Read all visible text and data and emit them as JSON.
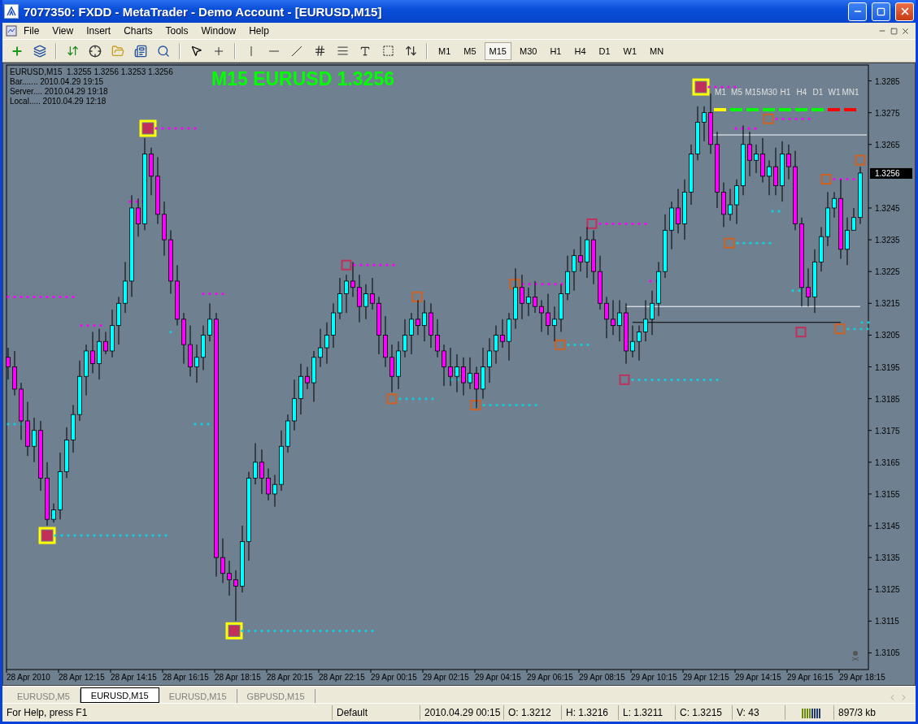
{
  "window": {
    "title": "7077350: FXDD - MetaTrader - Demo Account - [EURUSD,M15]"
  },
  "menu": [
    "File",
    "View",
    "Insert",
    "Charts",
    "Tools",
    "Window",
    "Help"
  ],
  "toolbar": {
    "timeframes": [
      {
        "label": "M1",
        "selected": false
      },
      {
        "label": "M5",
        "selected": false
      },
      {
        "label": "M15",
        "selected": true
      },
      {
        "label": "M30",
        "selected": false
      },
      {
        "label": "H1",
        "selected": false
      },
      {
        "label": "H4",
        "selected": false
      },
      {
        "label": "D1",
        "selected": false
      },
      {
        "label": "W1",
        "selected": false
      },
      {
        "label": "MN",
        "selected": false
      }
    ]
  },
  "chart": {
    "info_lines": [
      "EURUSD,M15  1.3255 1.3256 1.3253 1.3256",
      "Bar....... 2010.04.29 19:15",
      "Server.... 2010.04.29 19:18",
      "Local..... 2010.04.29 12:18"
    ],
    "headline": "M15 EURUSD 1.3256",
    "legend": [
      {
        "label": "M1",
        "color": "#ffff00"
      },
      {
        "label": "M5",
        "color": "#00ff00"
      },
      {
        "label": "M15",
        "color": "#00ff00"
      },
      {
        "label": "M30",
        "color": "#00ff00"
      },
      {
        "label": "H1",
        "color": "#00ff00"
      },
      {
        "label": "H4",
        "color": "#00ff00"
      },
      {
        "label": "D1",
        "color": "#00ff00"
      },
      {
        "label": "W1",
        "color": "#ff0000"
      },
      {
        "label": "MN1",
        "color": "#ff0000"
      }
    ],
    "current_price": "1.3256",
    "time_axis": [
      "28 Apr 2010",
      "28 Apr 12:15",
      "28 Apr 14:15",
      "28 Apr 16:15",
      "28 Apr 18:15",
      "28 Apr 20:15",
      "28 Apr 22:15",
      "29 Apr 00:15",
      "29 Apr 02:15",
      "29 Apr 04:15",
      "29 Apr 06:15",
      "29 Apr 08:15",
      "29 Apr 10:15",
      "29 Apr 12:15",
      "29 Apr 14:15",
      "29 Apr 16:15",
      "29 Apr 18:15"
    ],
    "chart_data": {
      "type": "candlestick",
      "ylim": [
        1.31,
        1.329
      ],
      "ref_lines": [
        {
          "axis": "y",
          "value": 1.3268,
          "color": "#ffffff"
        },
        {
          "axis": "y",
          "value": 1.3214,
          "color": "#ffffff"
        },
        {
          "axis": "y",
          "value": 1.3209,
          "color": "#000000"
        }
      ],
      "yticks": [
        {
          "value": 1.3285,
          "label": "1.3285"
        },
        {
          "value": 1.3275,
          "label": "1.3275"
        },
        {
          "value": 1.3265,
          "label": "1.3265"
        },
        {
          "value": 1.3245,
          "label": "1.3245"
        },
        {
          "value": 1.3235,
          "label": "1.3235"
        },
        {
          "value": 1.3225,
          "label": "1.3225"
        },
        {
          "value": 1.3215,
          "label": "1.3215"
        },
        {
          "value": 1.3205,
          "label": "1.3205"
        },
        {
          "value": 1.3195,
          "label": "1.3195"
        },
        {
          "value": 1.3185,
          "label": "1.3185"
        },
        {
          "value": 1.3175,
          "label": "1.3175"
        },
        {
          "value": 1.3165,
          "label": "1.3165"
        },
        {
          "value": 1.3155,
          "label": "1.3155"
        },
        {
          "value": 1.3145,
          "label": "1.3145"
        },
        {
          "value": 1.3135,
          "label": "1.3135"
        },
        {
          "value": 1.3125,
          "label": "1.3125"
        },
        {
          "value": 1.3115,
          "label": "1.3115"
        },
        {
          "value": 1.3105,
          "label": "1.3105"
        }
      ],
      "ohlc": [
        [
          1.3198,
          1.3201,
          1.3191,
          1.3195
        ],
        [
          1.3195,
          1.32,
          1.3186,
          1.3188
        ],
        [
          1.3188,
          1.319,
          1.3172,
          1.3178
        ],
        [
          1.3178,
          1.3184,
          1.3167,
          1.317
        ],
        [
          1.317,
          1.3179,
          1.3165,
          1.3175
        ],
        [
          1.3175,
          1.3178,
          1.3156,
          1.316
        ],
        [
          1.316,
          1.3165,
          1.3145,
          1.3147
        ],
        [
          1.3147,
          1.3152,
          1.3146,
          1.315
        ],
        [
          1.315,
          1.3168,
          1.3147,
          1.3162
        ],
        [
          1.3162,
          1.3176,
          1.316,
          1.3172
        ],
        [
          1.3172,
          1.3183,
          1.3168,
          1.318
        ],
        [
          1.318,
          1.3197,
          1.3178,
          1.3192
        ],
        [
          1.3192,
          1.3202,
          1.3186,
          1.32
        ],
        [
          1.32,
          1.3206,
          1.3193,
          1.3196
        ],
        [
          1.3196,
          1.3207,
          1.3191,
          1.3203
        ],
        [
          1.3203,
          1.3206,
          1.3199,
          1.32
        ],
        [
          1.32,
          1.3213,
          1.3198,
          1.3208
        ],
        [
          1.3208,
          1.3217,
          1.3202,
          1.3215
        ],
        [
          1.3215,
          1.3228,
          1.3212,
          1.3222
        ],
        [
          1.3222,
          1.3249,
          1.3217,
          1.3245
        ],
        [
          1.3245,
          1.3248,
          1.3236,
          1.324
        ],
        [
          1.324,
          1.3267,
          1.3238,
          1.3262
        ],
        [
          1.3262,
          1.3264,
          1.3249,
          1.3255
        ],
        [
          1.3255,
          1.3261,
          1.324,
          1.3243
        ],
        [
          1.3243,
          1.3247,
          1.323,
          1.3235
        ],
        [
          1.3235,
          1.3238,
          1.3218,
          1.3222
        ],
        [
          1.3222,
          1.3227,
          1.3208,
          1.321
        ],
        [
          1.321,
          1.3212,
          1.3196,
          1.3202
        ],
        [
          1.3202,
          1.3208,
          1.3192,
          1.3195
        ],
        [
          1.3195,
          1.3202,
          1.319,
          1.3198
        ],
        [
          1.3198,
          1.3208,
          1.3194,
          1.3205
        ],
        [
          1.3205,
          1.3215,
          1.3203,
          1.321
        ],
        [
          1.321,
          1.3212,
          1.3129,
          1.3135
        ],
        [
          1.3135,
          1.3141,
          1.3127,
          1.313
        ],
        [
          1.313,
          1.3134,
          1.3123,
          1.3128
        ],
        [
          1.3128,
          1.3131,
          1.3115,
          1.3126
        ],
        [
          1.3126,
          1.3145,
          1.3124,
          1.314
        ],
        [
          1.314,
          1.3162,
          1.3134,
          1.316
        ],
        [
          1.316,
          1.3171,
          1.3158,
          1.3165
        ],
        [
          1.3165,
          1.3169,
          1.3155,
          1.316
        ],
        [
          1.316,
          1.3163,
          1.3153,
          1.3155
        ],
        [
          1.3155,
          1.3161,
          1.3151,
          1.3158
        ],
        [
          1.3158,
          1.3175,
          1.3156,
          1.317
        ],
        [
          1.317,
          1.318,
          1.3168,
          1.3178
        ],
        [
          1.3178,
          1.3191,
          1.3175,
          1.3185
        ],
        [
          1.3185,
          1.3196,
          1.318,
          1.3192
        ],
        [
          1.3192,
          1.3195,
          1.3188,
          1.319
        ],
        [
          1.319,
          1.32,
          1.3184,
          1.3198
        ],
        [
          1.3198,
          1.3207,
          1.3195,
          1.3201
        ],
        [
          1.3201,
          1.3209,
          1.3196,
          1.3205
        ],
        [
          1.3205,
          1.3215,
          1.3201,
          1.3212
        ],
        [
          1.3212,
          1.3223,
          1.321,
          1.3218
        ],
        [
          1.3218,
          1.3224,
          1.3212,
          1.3222
        ],
        [
          1.3222,
          1.3228,
          1.3217,
          1.322
        ],
        [
          1.322,
          1.3224,
          1.3209,
          1.3214
        ],
        [
          1.3214,
          1.3221,
          1.321,
          1.3218
        ],
        [
          1.3218,
          1.3223,
          1.3213,
          1.3215
        ],
        [
          1.3215,
          1.3217,
          1.3199,
          1.3205
        ],
        [
          1.3205,
          1.3211,
          1.3195,
          1.3198
        ],
        [
          1.3198,
          1.3202,
          1.3187,
          1.3192
        ],
        [
          1.3192,
          1.3203,
          1.3188,
          1.32
        ],
        [
          1.32,
          1.321,
          1.3198,
          1.3205
        ],
        [
          1.3205,
          1.3212,
          1.3199,
          1.321
        ],
        [
          1.321,
          1.3216,
          1.3205,
          1.3208
        ],
        [
          1.3208,
          1.3216,
          1.3203,
          1.3212
        ],
        [
          1.3212,
          1.3215,
          1.3201,
          1.3205
        ],
        [
          1.3205,
          1.321,
          1.3198,
          1.32
        ],
        [
          1.32,
          1.3202,
          1.3189,
          1.3195
        ],
        [
          1.3195,
          1.3201,
          1.3189,
          1.3192
        ],
        [
          1.3192,
          1.3199,
          1.3187,
          1.3195
        ],
        [
          1.3195,
          1.3198,
          1.3186,
          1.319
        ],
        [
          1.319,
          1.3198,
          1.3188,
          1.3193
        ],
        [
          1.3193,
          1.3195,
          1.3182,
          1.3188
        ],
        [
          1.3188,
          1.3201,
          1.3185,
          1.3195
        ],
        [
          1.3195,
          1.3204,
          1.319,
          1.32
        ],
        [
          1.32,
          1.3208,
          1.3196,
          1.3205
        ],
        [
          1.3205,
          1.321,
          1.3201,
          1.3203
        ],
        [
          1.3203,
          1.3212,
          1.3197,
          1.321
        ],
        [
          1.321,
          1.3226,
          1.3207,
          1.322
        ],
        [
          1.322,
          1.3224,
          1.321,
          1.3215
        ],
        [
          1.3215,
          1.322,
          1.3211,
          1.3217
        ],
        [
          1.3217,
          1.3222,
          1.3212,
          1.3214
        ],
        [
          1.3214,
          1.3216,
          1.3206,
          1.3212
        ],
        [
          1.3212,
          1.3218,
          1.3205,
          1.3208
        ],
        [
          1.3208,
          1.3214,
          1.3203,
          1.321
        ],
        [
          1.321,
          1.3221,
          1.3206,
          1.3218
        ],
        [
          1.3218,
          1.323,
          1.3216,
          1.3225
        ],
        [
          1.3225,
          1.3232,
          1.3219,
          1.323
        ],
        [
          1.323,
          1.3236,
          1.3225,
          1.3228
        ],
        [
          1.3228,
          1.3239,
          1.3223,
          1.3235
        ],
        [
          1.3235,
          1.3238,
          1.3221,
          1.3225
        ],
        [
          1.3225,
          1.323,
          1.3213,
          1.3215
        ],
        [
          1.3215,
          1.3217,
          1.3204,
          1.321
        ],
        [
          1.321,
          1.3216,
          1.3205,
          1.3208
        ],
        [
          1.3208,
          1.3216,
          1.3203,
          1.3212
        ],
        [
          1.3212,
          1.3215,
          1.3196,
          1.32
        ],
        [
          1.32,
          1.3208,
          1.3198,
          1.3203
        ],
        [
          1.3203,
          1.3208,
          1.3197,
          1.3206
        ],
        [
          1.3206,
          1.3216,
          1.3203,
          1.321
        ],
        [
          1.321,
          1.3219,
          1.3205,
          1.3215
        ],
        [
          1.3215,
          1.3228,
          1.3211,
          1.3225
        ],
        [
          1.3225,
          1.3243,
          1.3223,
          1.3238
        ],
        [
          1.3238,
          1.3247,
          1.3232,
          1.3245
        ],
        [
          1.3245,
          1.3251,
          1.3237,
          1.324
        ],
        [
          1.324,
          1.3254,
          1.3235,
          1.325
        ],
        [
          1.325,
          1.3265,
          1.3246,
          1.3262
        ],
        [
          1.3262,
          1.3277,
          1.326,
          1.3272
        ],
        [
          1.3272,
          1.3277,
          1.3266,
          1.3275
        ],
        [
          1.3275,
          1.3281,
          1.3262,
          1.3265
        ],
        [
          1.3265,
          1.3269,
          1.3245,
          1.325
        ],
        [
          1.325,
          1.3253,
          1.3239,
          1.3243
        ],
        [
          1.3243,
          1.3251,
          1.3241,
          1.3246
        ],
        [
          1.3246,
          1.3254,
          1.324,
          1.3252
        ],
        [
          1.3252,
          1.3271,
          1.3249,
          1.3265
        ],
        [
          1.3265,
          1.3269,
          1.3255,
          1.326
        ],
        [
          1.326,
          1.3265,
          1.3256,
          1.3262
        ],
        [
          1.3262,
          1.3267,
          1.3253,
          1.3255
        ],
        [
          1.3255,
          1.326,
          1.3249,
          1.3258
        ],
        [
          1.3258,
          1.3264,
          1.3249,
          1.3252
        ],
        [
          1.3252,
          1.3266,
          1.3247,
          1.3262
        ],
        [
          1.3262,
          1.3265,
          1.3254,
          1.3258
        ],
        [
          1.3258,
          1.3263,
          1.3238,
          1.324
        ],
        [
          1.324,
          1.3242,
          1.3214,
          1.322
        ],
        [
          1.322,
          1.3226,
          1.3214,
          1.3217
        ],
        [
          1.3217,
          1.3232,
          1.3212,
          1.3228
        ],
        [
          1.3228,
          1.3239,
          1.3225,
          1.3236
        ],
        [
          1.3236,
          1.325,
          1.3233,
          1.3245
        ],
        [
          1.3245,
          1.325,
          1.3242,
          1.3248
        ],
        [
          1.3248,
          1.3254,
          1.3229,
          1.3232
        ],
        [
          1.3232,
          1.3242,
          1.3227,
          1.3238
        ],
        [
          1.3238,
          1.3245,
          1.3238,
          1.3242
        ],
        [
          1.3242,
          1.3258,
          1.324,
          1.3256
        ]
      ]
    }
  },
  "tabs": [
    {
      "label": "EURUSD,M5",
      "selected": false
    },
    {
      "label": "EURUSD,M15",
      "selected": true
    },
    {
      "label": "EURUSD,M15",
      "selected": false
    },
    {
      "label": "GBPUSD,M15",
      "selected": false
    }
  ],
  "status_bar": {
    "help": "For Help, press F1",
    "profile": "Default",
    "time": "2010.04.29 00:15",
    "open": "O: 1.3212",
    "high": "H: 1.3216",
    "low": "L: 1.3211",
    "close": "C: 1.3215",
    "volume": "V: 43",
    "traffic": "897/3 kb"
  }
}
